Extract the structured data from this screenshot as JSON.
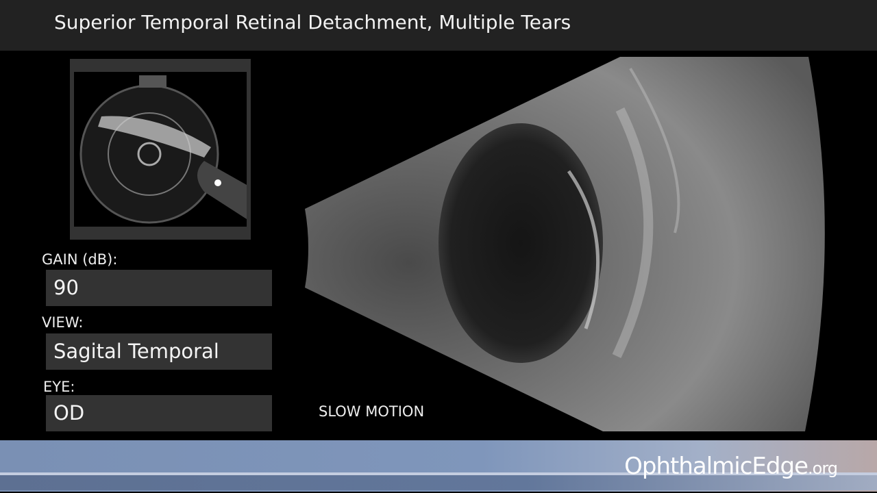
{
  "header": {
    "title": "Superior Temporal Retinal Detachment, Multiple Tears"
  },
  "panel": {
    "gain_label": "GAIN (dB):",
    "gain_value": "90",
    "view_label": "VIEW:",
    "view_value": "Sagital Temporal",
    "eye_label": "EYE:",
    "eye_value": "OD"
  },
  "playback": {
    "mode": "SLOW MOTION"
  },
  "footer": {
    "brand_main": "OphthalmicEdge",
    "brand_suffix": ".org"
  }
}
